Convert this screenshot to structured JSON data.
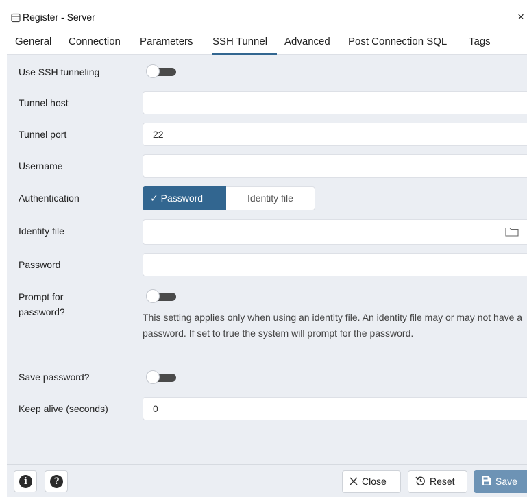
{
  "window": {
    "title": "Register - Server",
    "close_glyph": "×"
  },
  "tabs": [
    {
      "label": "General"
    },
    {
      "label": "Connection"
    },
    {
      "label": "Parameters"
    },
    {
      "label": "SSH Tunnel",
      "active": true
    },
    {
      "label": "Advanced"
    },
    {
      "label": "Post Connection SQL"
    },
    {
      "label": "Tags"
    }
  ],
  "form": {
    "use_ssh": {
      "label": "Use SSH tunneling",
      "value": false
    },
    "tunnel_host": {
      "label": "Tunnel host",
      "value": ""
    },
    "tunnel_port": {
      "label": "Tunnel port",
      "value": "22"
    },
    "username": {
      "label": "Username",
      "value": ""
    },
    "authentication": {
      "label": "Authentication",
      "options": [
        "Password",
        "Identity file"
      ],
      "selected": "Password",
      "check_glyph": "✓"
    },
    "identity_file": {
      "label": "Identity file",
      "value": ""
    },
    "password": {
      "label": "Password",
      "value": ""
    },
    "prompt_password": {
      "label_line1": "Prompt for",
      "label_line2": "password?",
      "value": false,
      "help": "This setting applies only when using an identity file. An identity file may or may not have a password. If set to true the system will prompt for the password."
    },
    "save_password": {
      "label": "Save password?",
      "value": false
    },
    "keep_alive": {
      "label": "Keep alive (seconds)",
      "value": "0"
    }
  },
  "footer": {
    "info_glyph": "i",
    "help_glyph": "?",
    "close_label": "Close",
    "reset_label": "Reset",
    "save_label": "Save"
  },
  "colors": {
    "accent": "#326690",
    "save_button": "#6d93b5",
    "background": "#ebeef3"
  }
}
